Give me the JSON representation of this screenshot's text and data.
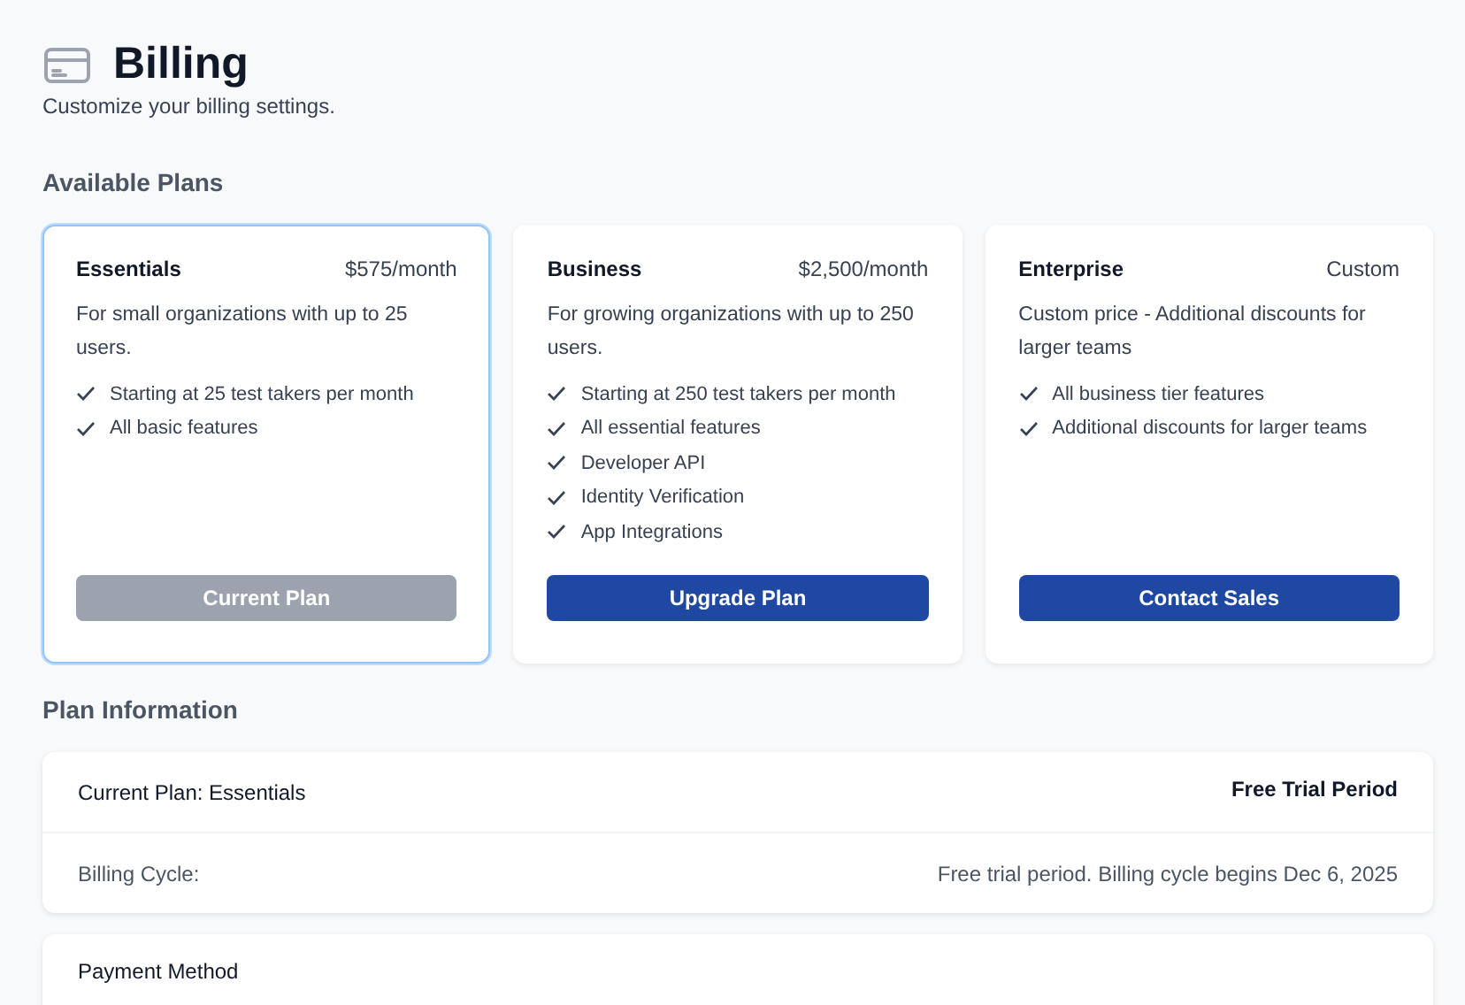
{
  "header": {
    "title": "Billing",
    "subtitle": "Customize your billing settings."
  },
  "plans_heading": "Available Plans",
  "plans": [
    {
      "name": "Essentials",
      "price": "$575/month",
      "description": "For small organizations with up to 25 users.",
      "features": [
        "Starting at 25 test takers per month",
        "All basic features"
      ],
      "selected": true,
      "button": {
        "label": "Current Plan",
        "disabled": true
      }
    },
    {
      "name": "Business",
      "price": "$2,500/month",
      "description": "For growing organizations with up to 250 users.",
      "features": [
        "Starting at 250 test takers per month",
        "All essential features",
        "Developer API",
        "Identity Verification",
        "App Integrations"
      ],
      "selected": false,
      "button": {
        "label": "Upgrade Plan",
        "disabled": false
      }
    },
    {
      "name": "Enterprise",
      "price": "Custom",
      "description": "Custom price - Additional discounts for larger teams",
      "features": [
        "All business tier features",
        "Additional discounts for larger teams"
      ],
      "selected": false,
      "button": {
        "label": "Contact Sales",
        "disabled": false
      }
    }
  ],
  "info_heading": "Plan Information",
  "plan_info": {
    "current_plan": "Current Plan: Essentials",
    "status": "Free Trial Period",
    "billing_cycle_label": "Billing Cycle:",
    "billing_cycle_value": "Free trial period. Billing cycle begins Dec 6, 2025"
  },
  "payment": {
    "title": "Payment Method"
  }
}
